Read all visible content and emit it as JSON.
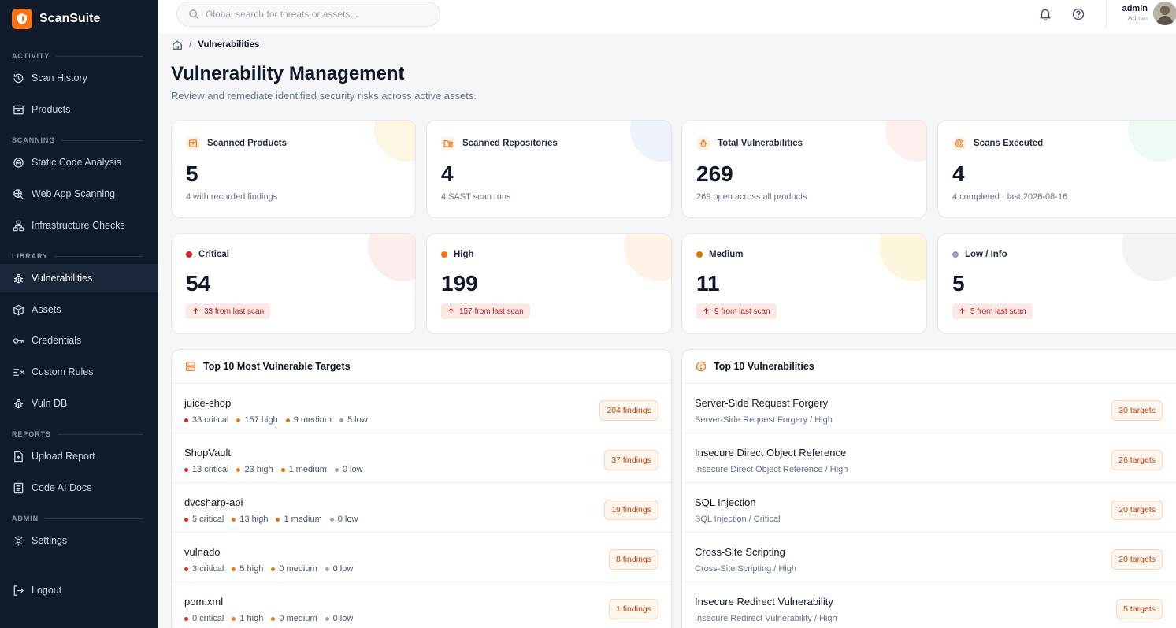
{
  "brand": {
    "name": "ScanSuite"
  },
  "sidebar": {
    "sections": [
      {
        "title": "ACTIVITY"
      },
      {
        "title": "SCANNING"
      },
      {
        "title": "LIBRARY"
      },
      {
        "title": "REPORTS"
      },
      {
        "title": "ADMIN"
      }
    ],
    "items": [
      {
        "label": "Scan History",
        "icon": "history-icon"
      },
      {
        "label": "Products",
        "icon": "archive-icon"
      },
      {
        "label": "Static Code Analysis",
        "icon": "target-icon"
      },
      {
        "label": "Web App Scanning",
        "icon": "globe-search-icon"
      },
      {
        "label": "Infrastructure Checks",
        "icon": "network-icon"
      },
      {
        "label": "Vulnerabilities",
        "icon": "bug-icon",
        "active": true
      },
      {
        "label": "Assets",
        "icon": "box-icon"
      },
      {
        "label": "Credentials",
        "icon": "key-icon"
      },
      {
        "label": "Custom Rules",
        "icon": "rules-icon"
      },
      {
        "label": "Vuln DB",
        "icon": "bug-icon"
      },
      {
        "label": "Upload Report",
        "icon": "upload-file-icon"
      },
      {
        "label": "Code AI Docs",
        "icon": "document-icon"
      },
      {
        "label": "Settings",
        "icon": "gear-icon"
      },
      {
        "label": "Logout",
        "icon": "logout-icon"
      }
    ]
  },
  "topbar": {
    "search_placeholder": "Global search for threats or assets...",
    "user_name": "admin",
    "user_role": "Admin"
  },
  "breadcrumb": {
    "current": "Vulnerabilities"
  },
  "page": {
    "title": "Vulnerability Management",
    "subtitle": "Review and remediate identified security risks across active assets."
  },
  "stats": [
    {
      "label": "Scanned Products",
      "value": "5",
      "note": "4 with recorded findings",
      "icon": "archive-icon"
    },
    {
      "label": "Scanned Repositories",
      "value": "4",
      "note": "4 SAST scan runs",
      "icon": "folder-git-icon"
    },
    {
      "label": "Total Vulnerabilities",
      "value": "269",
      "note": "269 open across all products",
      "icon": "bug-icon"
    },
    {
      "label": "Scans Executed",
      "value": "4",
      "note": "4 completed · last 2026-08-16",
      "icon": "target-icon"
    }
  ],
  "severity": [
    {
      "label": "Critical",
      "value": "54",
      "delta": "33 from last scan",
      "color": "#dc2626"
    },
    {
      "label": "High",
      "value": "199",
      "delta": "157 from last scan",
      "color": "#f97316"
    },
    {
      "label": "Medium",
      "value": "11",
      "delta": "9 from last scan",
      "color": "#d97706"
    },
    {
      "label": "Low / Info",
      "value": "5",
      "delta": "5 from last scan",
      "color": "#94a3b8"
    }
  ],
  "targets": {
    "title": "Top 10 Most Vulnerable Targets",
    "rows": [
      {
        "name": "juice-shop",
        "critical": "33 critical",
        "high": "157 high",
        "medium": "9 medium",
        "low": "5 low",
        "findings": "204 findings"
      },
      {
        "name": "ShopVault",
        "critical": "13 critical",
        "high": "23 high",
        "medium": "1 medium",
        "low": "0 low",
        "findings": "37 findings"
      },
      {
        "name": "dvcsharp-api",
        "critical": "5 critical",
        "high": "13 high",
        "medium": "1 medium",
        "low": "0 low",
        "findings": "19 findings"
      },
      {
        "name": "vulnado",
        "critical": "3 critical",
        "high": "5 high",
        "medium": "0 medium",
        "low": "0 low",
        "findings": "8 findings"
      },
      {
        "name": "pom.xml",
        "critical": "0 critical",
        "high": "1 high",
        "medium": "0 medium",
        "low": "0 low",
        "findings": "1 findings"
      }
    ]
  },
  "vulns": {
    "title": "Top 10 Vulnerabilities",
    "rows": [
      {
        "name": "Server-Side Request Forgery",
        "sub": "Server-Side Request Forgery / High",
        "targets": "30 targets"
      },
      {
        "name": "Insecure Direct Object Reference",
        "sub": "Insecure Direct Object Reference / High",
        "targets": "26 targets"
      },
      {
        "name": "SQL Injection",
        "sub": "SQL Injection / Critical",
        "targets": "20 targets"
      },
      {
        "name": "Cross-Site Scripting",
        "sub": "Cross-Site Scripting / High",
        "targets": "20 targets"
      },
      {
        "name": "Insecure Redirect Vulnerability",
        "sub": "Insecure Redirect Vulnerability / High",
        "targets": "5 targets"
      }
    ]
  },
  "colors": {
    "accent": "#f97316",
    "sidebar_bg": "#0f1a2b",
    "critical": "#dc2626",
    "high": "#f97316",
    "medium": "#d97706",
    "low": "#94a3b8"
  }
}
